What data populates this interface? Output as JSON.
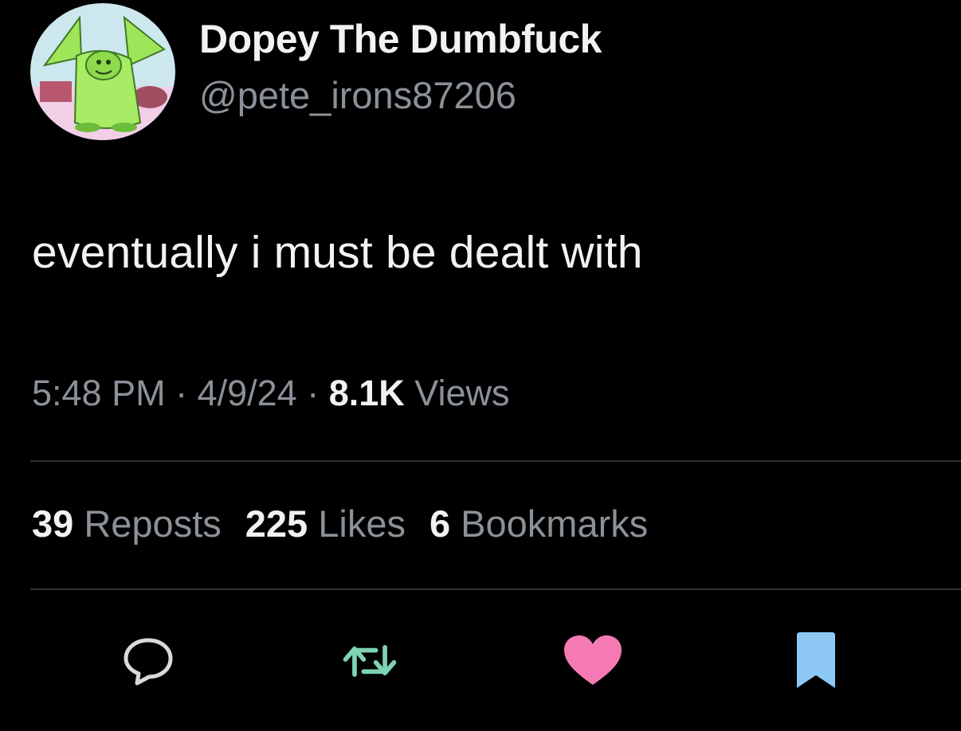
{
  "tweet": {
    "author": {
      "display_name": "Dopey The Dumbfuck",
      "handle": "@pete_irons87206"
    },
    "text": "eventually i must be dealt with",
    "meta": {
      "time": "5:48 PM",
      "separator": " · ",
      "date": "4/9/24",
      "views_count": "8.1K",
      "views_label": " Views"
    },
    "stats": [
      {
        "count": "39",
        "label": " Reposts"
      },
      {
        "count": "225",
        "label": " Likes"
      },
      {
        "count": "6",
        "label": " Bookmarks"
      }
    ],
    "actions": [
      {
        "icon": "reply-icon",
        "color": "#d9d9d9"
      },
      {
        "icon": "repost-icon",
        "color": "#7ed3b2"
      },
      {
        "icon": "heart-icon",
        "color": "#f57ab4"
      },
      {
        "icon": "bookmark-icon",
        "color": "#8ec9f5"
      }
    ]
  },
  "colors": {
    "background": "#000000",
    "primary_text": "#f2f2f2",
    "secondary_text": "#8b9198",
    "divider": "#2f3336"
  }
}
